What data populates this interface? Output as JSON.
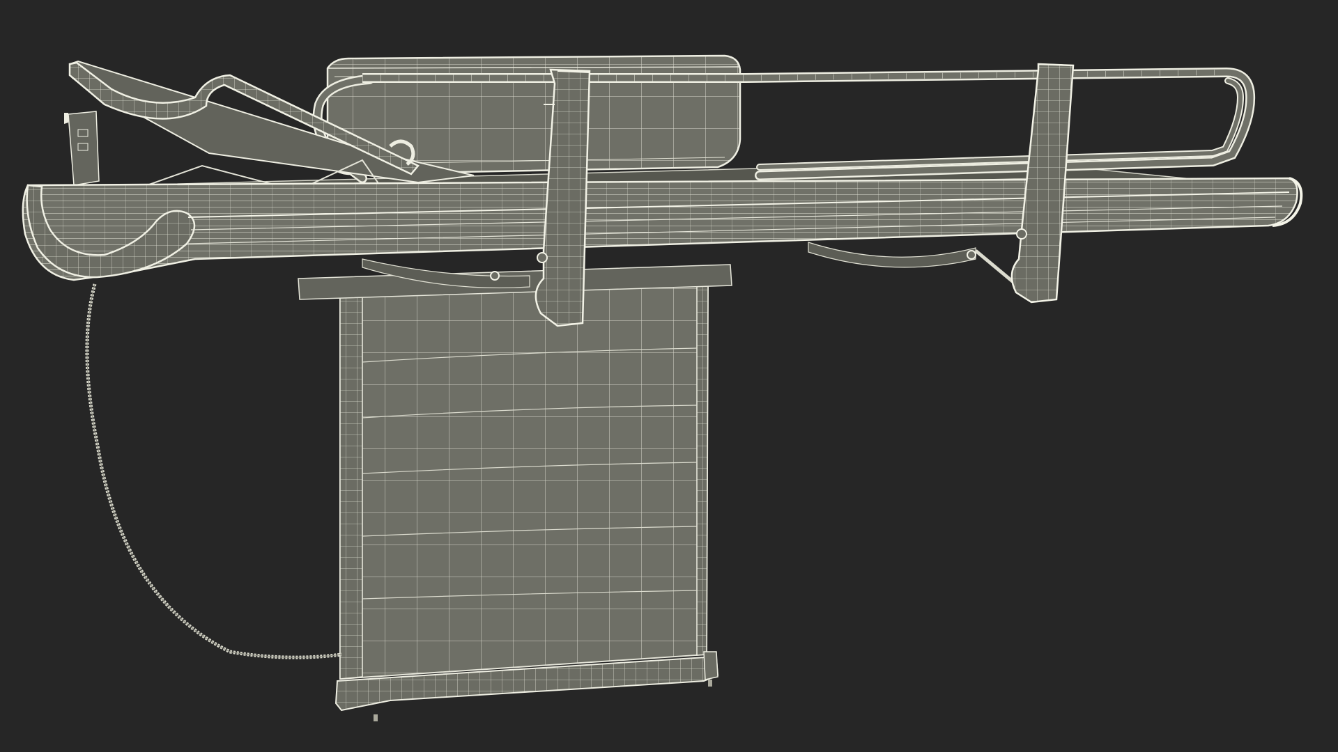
{
  "scene": {
    "subject": "wireframe-3d-model",
    "colors": {
      "background": "#262626",
      "surface_fill": "#6e6f66",
      "surface_fill_dark": "#5f6058",
      "wire": "#e4e4d8",
      "wire_dense": "#f2f2e8",
      "shadow": "#44453f"
    }
  }
}
